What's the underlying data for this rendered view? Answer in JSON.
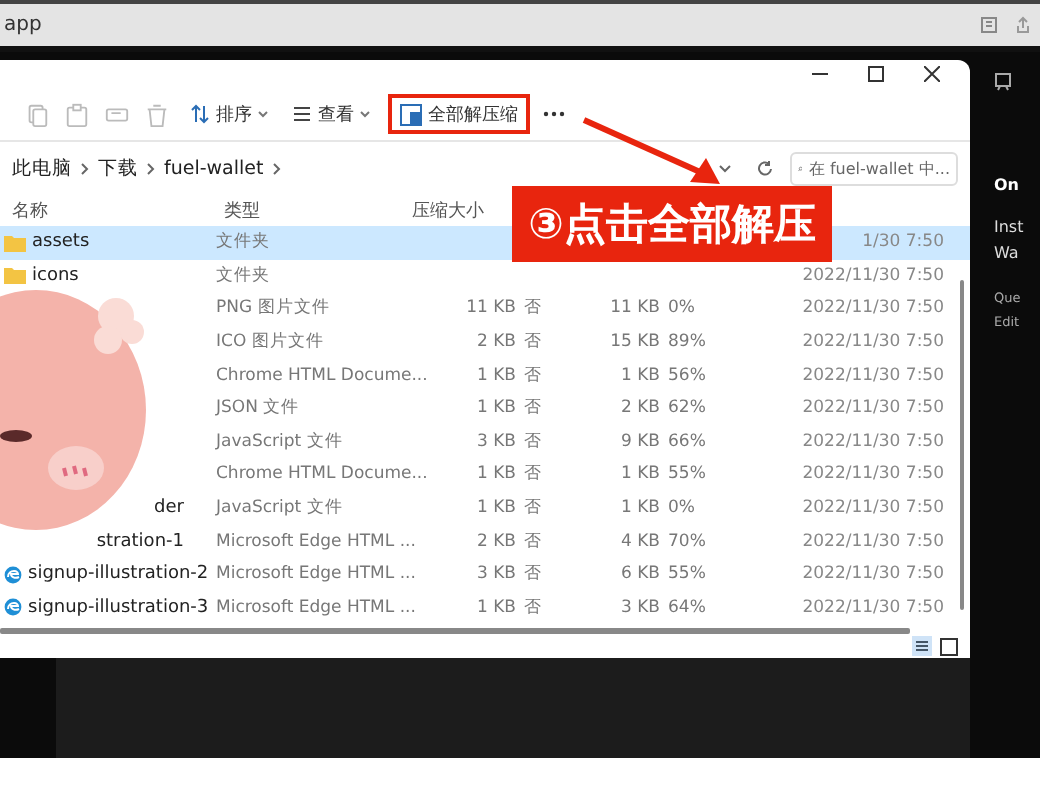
{
  "top_bar": {
    "title": "app"
  },
  "explorer": {
    "toolbar": {
      "sort_label": "排序",
      "view_label": "查看",
      "extract_label": "全部解压缩"
    },
    "breadcrumb": [
      "此电脑",
      "下载",
      "fuel-wallet"
    ],
    "search": {
      "placeholder": "在 fuel-wallet 中..."
    },
    "columns": {
      "name": "名称",
      "type": "类型",
      "compressed_size": "压缩大小"
    },
    "rows": [
      {
        "kind": "folder",
        "name": "assets",
        "type": "文件夹",
        "date": "1/30 7:50",
        "selected": true
      },
      {
        "kind": "folder",
        "name": "icons",
        "type": "文件夹",
        "date": "2022/11/30 7:50",
        "selected": false
      },
      {
        "kind": "covered",
        "type": "PNG 图片文件",
        "compressed_size": "11 KB",
        "password": "否",
        "size": "11 KB",
        "ratio": "0%",
        "date": "2022/11/30 7:50",
        "selected": false
      },
      {
        "kind": "covered",
        "type": "ICO 图片文件",
        "compressed_size": "2 KB",
        "password": "否",
        "size": "15 KB",
        "ratio": "89%",
        "date": "2022/11/30 7:50",
        "selected": false
      },
      {
        "kind": "covered",
        "type": "Chrome HTML Docume...",
        "compressed_size": "1 KB",
        "password": "否",
        "size": "1 KB",
        "ratio": "56%",
        "date": "2022/11/30 7:50",
        "selected": false
      },
      {
        "kind": "covered",
        "type": "JSON 文件",
        "compressed_size": "1 KB",
        "password": "否",
        "size": "2 KB",
        "ratio": "62%",
        "date": "2022/11/30 7:50",
        "selected": false
      },
      {
        "kind": "covered",
        "type": "JavaScript 文件",
        "compressed_size": "3 KB",
        "password": "否",
        "size": "9 KB",
        "ratio": "66%",
        "date": "2022/11/30 7:50",
        "selected": false
      },
      {
        "kind": "covered",
        "type": "Chrome HTML Docume...",
        "compressed_size": "1 KB",
        "password": "否",
        "size": "1 KB",
        "ratio": "55%",
        "date": "2022/11/30 7:50",
        "selected": false
      },
      {
        "kind": "covered",
        "name": "der",
        "type": "JavaScript 文件",
        "compressed_size": "1 KB",
        "password": "否",
        "size": "1 KB",
        "ratio": "0%",
        "date": "2022/11/30 7:50",
        "selected": false
      },
      {
        "kind": "covered",
        "name": "stration-1",
        "type": "Microsoft Edge HTML ...",
        "compressed_size": "2 KB",
        "password": "否",
        "size": "4 KB",
        "ratio": "70%",
        "date": "2022/11/30 7:50",
        "selected": false
      },
      {
        "kind": "edge",
        "name": "signup-illustration-2",
        "type": "Microsoft Edge HTML ...",
        "compressed_size": "3 KB",
        "password": "否",
        "size": "6 KB",
        "ratio": "55%",
        "date": "2022/11/30 7:50",
        "selected": false
      },
      {
        "kind": "edge",
        "name": "signup-illustration-3",
        "type": "Microsoft Edge HTML ...",
        "compressed_size": "1 KB",
        "password": "否",
        "size": "3 KB",
        "ratio": "64%",
        "date": "2022/11/30 7:50",
        "selected": false
      }
    ]
  },
  "side_panel": [
    {
      "kind": "heading",
      "text": "On"
    },
    {
      "kind": "body",
      "text": "Inst"
    },
    {
      "kind": "body",
      "text": "Wa"
    },
    {
      "kind": "small",
      "text": "Que"
    },
    {
      "kind": "small",
      "text": "Edit"
    }
  ],
  "callout": {
    "text": "③点击全部解压"
  }
}
